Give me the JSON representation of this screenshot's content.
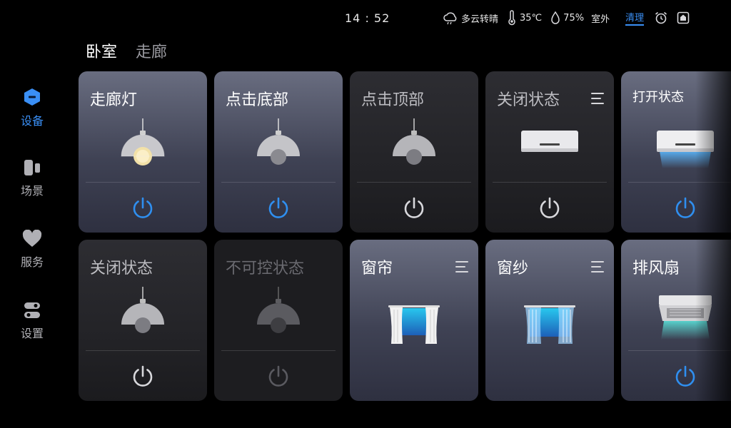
{
  "status_bar": {
    "time": "14 : 52",
    "weather": "多云转晴",
    "temperature": "35℃",
    "humidity": "75%",
    "location": "室外",
    "clean_label": "清理"
  },
  "rooms": [
    {
      "label": "卧室",
      "active": true
    },
    {
      "label": "走廊",
      "active": false
    }
  ],
  "sidebar": {
    "items": [
      {
        "label": "设备",
        "icon": "device-icon",
        "active": true
      },
      {
        "label": "场景",
        "icon": "scene-icon",
        "active": false
      },
      {
        "label": "服务",
        "icon": "heart-icon",
        "active": false
      },
      {
        "label": "设置",
        "icon": "toggle-settings-icon",
        "active": false
      }
    ]
  },
  "devices": [
    {
      "title": "走廊灯",
      "type": "lamp",
      "state": "on",
      "power_color": "#2f8ff0"
    },
    {
      "title": "点击底部",
      "type": "lamp",
      "state": "off",
      "power_color": "#2f8ff0"
    },
    {
      "title": "点击顶部",
      "type": "lamp",
      "state": "off",
      "power_color": "#d8d8dc"
    },
    {
      "title": "关闭状态",
      "type": "air-conditioner",
      "state": "off",
      "power_color": "#d8d8dc"
    },
    {
      "title": "打开状态",
      "type": "air-conditioner",
      "state": "on",
      "power_color": "#2f8ff0"
    },
    {
      "title": "关闭状态",
      "type": "lamp",
      "state": "off",
      "power_color": "#d8d8dc"
    },
    {
      "title": "不可控状态",
      "type": "lamp",
      "state": "disabled",
      "power_color": "#5a5a60"
    },
    {
      "title": "窗帘",
      "type": "curtain",
      "state": "on"
    },
    {
      "title": "窗纱",
      "type": "sheer",
      "state": "on"
    },
    {
      "title": "排风扇",
      "type": "exhaust-fan",
      "state": "on",
      "power_color": "#2f8ff0"
    }
  ],
  "colors": {
    "accent": "#3a8ff5",
    "background": "#000000"
  }
}
